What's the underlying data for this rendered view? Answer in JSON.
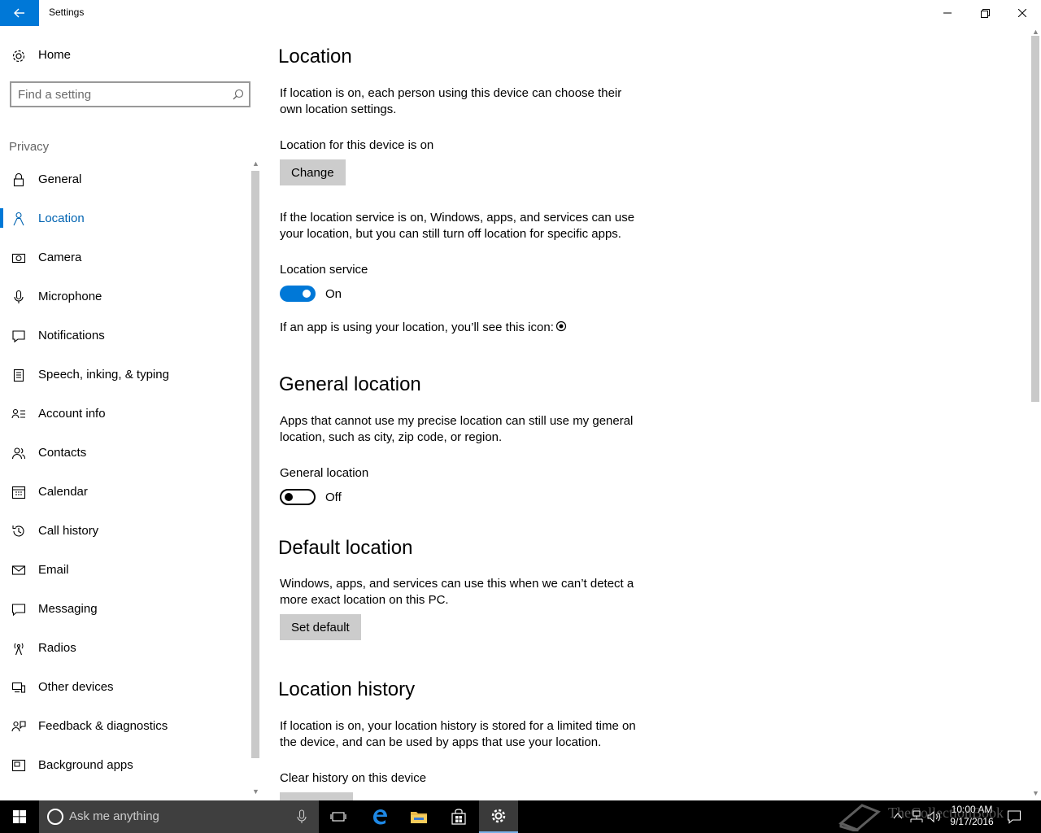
{
  "window": {
    "title": "Settings"
  },
  "sidebar": {
    "home_label": "Home",
    "search_placeholder": "Find a setting",
    "section": "Privacy",
    "items": [
      {
        "label": "General",
        "icon": "lock-icon",
        "active": false
      },
      {
        "label": "Location",
        "icon": "location-person-icon",
        "active": true
      },
      {
        "label": "Camera",
        "icon": "camera-icon",
        "active": false
      },
      {
        "label": "Microphone",
        "icon": "microphone-icon",
        "active": false
      },
      {
        "label": "Notifications",
        "icon": "notifications-icon",
        "active": false
      },
      {
        "label": "Speech, inking, & typing",
        "icon": "clipboard-icon",
        "active": false
      },
      {
        "label": "Account info",
        "icon": "account-info-icon",
        "active": false
      },
      {
        "label": "Contacts",
        "icon": "contacts-icon",
        "active": false
      },
      {
        "label": "Calendar",
        "icon": "calendar-icon",
        "active": false
      },
      {
        "label": "Call history",
        "icon": "history-icon",
        "active": false
      },
      {
        "label": "Email",
        "icon": "mail-icon",
        "active": false
      },
      {
        "label": "Messaging",
        "icon": "message-icon",
        "active": false
      },
      {
        "label": "Radios",
        "icon": "radio-tower-icon",
        "active": false
      },
      {
        "label": "Other devices",
        "icon": "devices-icon",
        "active": false
      },
      {
        "label": "Feedback & diagnostics",
        "icon": "feedback-icon",
        "active": false
      },
      {
        "label": "Background apps",
        "icon": "background-apps-icon",
        "active": false
      }
    ]
  },
  "main": {
    "location": {
      "title": "Location",
      "intro": "If location is on, each person using this device can choose their own location settings.",
      "device_status": "Location for this device is on",
      "change_button": "Change",
      "service_desc": "If the location service is on, Windows, apps, and services can use your location, but you can still turn off location for specific apps.",
      "service_label": "Location service",
      "service_state": "On",
      "service_on": true,
      "icon_note": "If an app is using your location, you’ll see this icon:"
    },
    "general_location": {
      "title": "General location",
      "desc": "Apps that cannot use my precise location can still use my general location, such as city, zip code, or region.",
      "label": "General location",
      "state": "Off",
      "on": false
    },
    "default_location": {
      "title": "Default location",
      "desc": "Windows, apps, and services can use this when we can’t detect a more exact location on this PC.",
      "button": "Set default"
    },
    "location_history": {
      "title": "Location history",
      "desc": "If location is on, your location history is stored for a limited time on the device, and can be used by apps that use your location.",
      "clear_label": "Clear history on this device"
    }
  },
  "taskbar": {
    "search_placeholder": "Ask me anything",
    "time": "10:00 AM",
    "date": "9/17/2016",
    "watermark": "TheCollectionBook"
  },
  "colors": {
    "accent": "#0078d7",
    "active_text": "#0063b1",
    "button_bg": "#cccccc",
    "taskbar": "#000000"
  }
}
